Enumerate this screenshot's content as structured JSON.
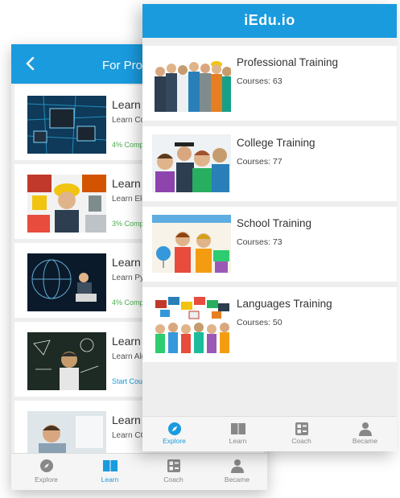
{
  "colors": {
    "accent": "#1a9bde",
    "progress_green": "#4caf50",
    "list_bg": "#eeeeee"
  },
  "back_phone": {
    "header": {
      "title": "For Profe",
      "back_icon": "chevron-left-icon"
    },
    "courses": [
      {
        "title": "Learn C",
        "subtitle": "Learn Co",
        "progress": "4% Complet",
        "progress_value": 0.04
      },
      {
        "title": "Learn E",
        "subtitle": "Learn Ele",
        "progress": "3% Complet",
        "progress_value": 0.03
      },
      {
        "title": "Learn P",
        "subtitle": "Learn Py",
        "progress": "4% Complet",
        "progress_value": 0.04
      },
      {
        "title": "Learn A",
        "subtitle": "Learn Alg",
        "progress": "Start Cour",
        "progress_value": 0
      },
      {
        "title": "Learn C",
        "subtitle": "Learn CC",
        "progress": "",
        "progress_value": 0
      }
    ],
    "tabs": [
      {
        "label": "Explore",
        "icon": "compass-icon",
        "active": false
      },
      {
        "label": "Learn",
        "icon": "book-icon",
        "active": true
      },
      {
        "label": "Coach",
        "icon": "dashboard-icon",
        "active": false
      },
      {
        "label": "Became",
        "icon": "person-icon",
        "active": false
      }
    ]
  },
  "front_phone": {
    "header": {
      "title": "iEdu.io"
    },
    "categories": [
      {
        "title": "Professional Training",
        "courses": "Courses: 63"
      },
      {
        "title": "College Training",
        "courses": "Courses: 77"
      },
      {
        "title": "School Training",
        "courses": "Courses: 73"
      },
      {
        "title": "Languages Training",
        "courses": "Courses: 50"
      }
    ],
    "tabs": [
      {
        "label": "Explore",
        "icon": "compass-icon",
        "active": true
      },
      {
        "label": "Learn",
        "icon": "book-icon",
        "active": false
      },
      {
        "label": "Coach",
        "icon": "dashboard-icon",
        "active": false
      },
      {
        "label": "Became",
        "icon": "person-icon",
        "active": false
      }
    ]
  }
}
